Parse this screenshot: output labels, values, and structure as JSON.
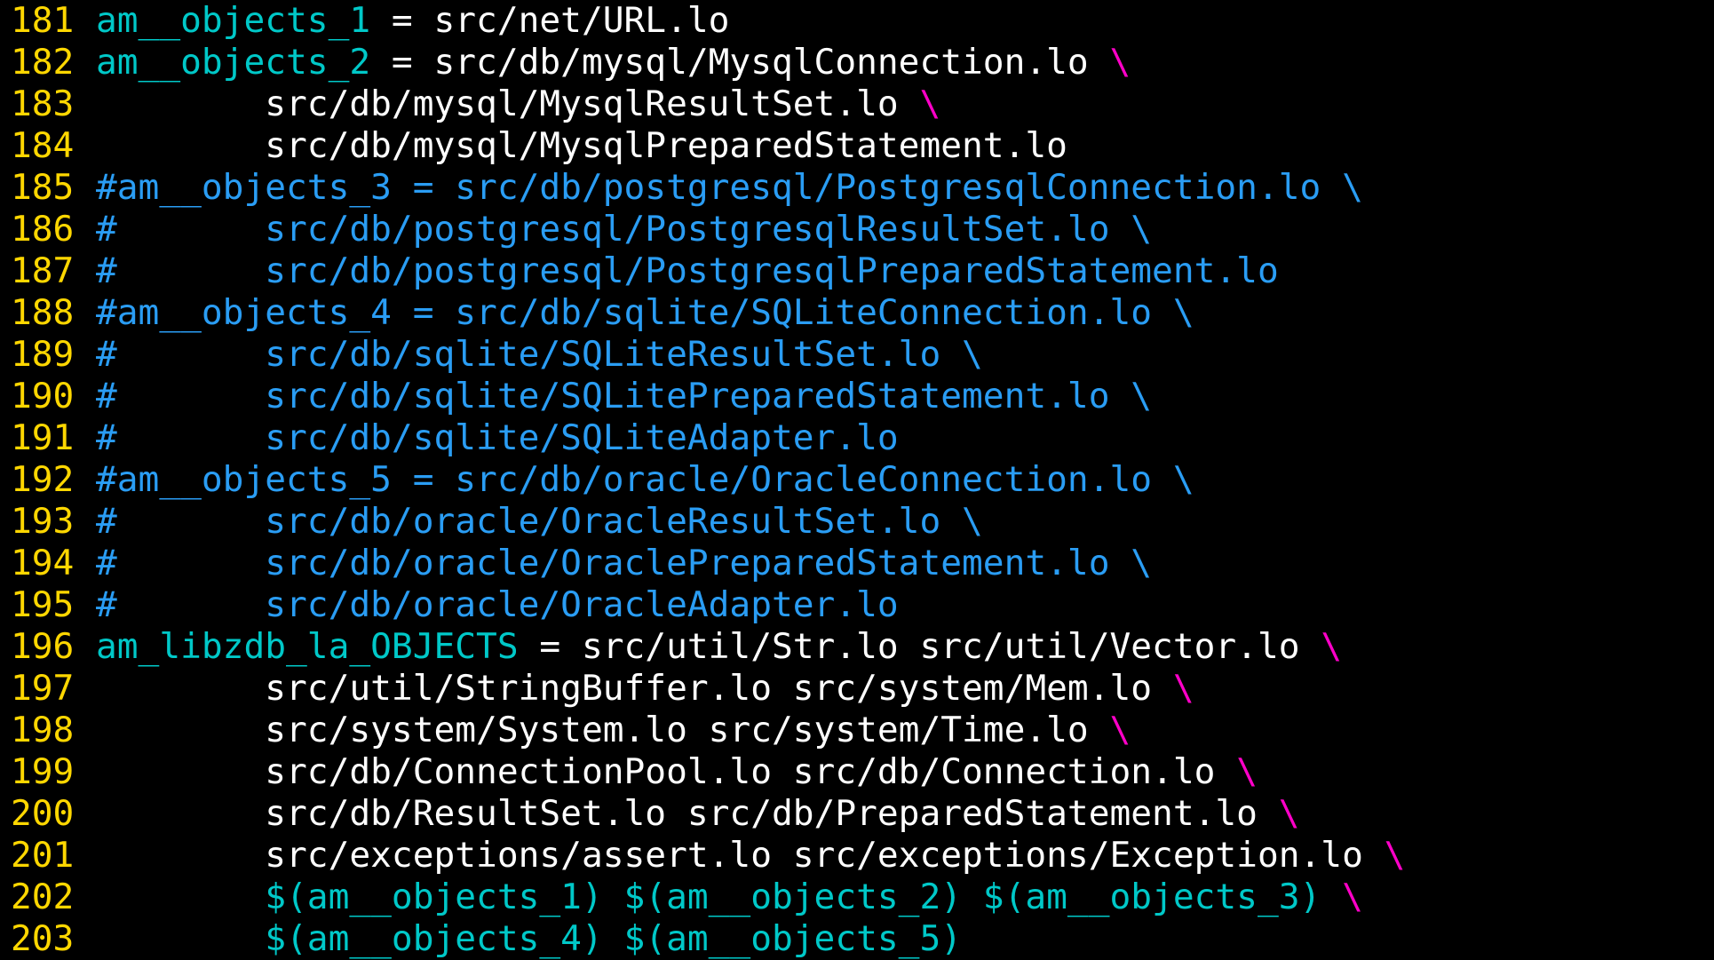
{
  "colors": {
    "background": "#000000",
    "line_number": "#ffd700",
    "variable": "#00c8c8",
    "plain": "#ffffff",
    "continuation": "#ff00c8",
    "comment": "#2a9df4"
  },
  "lines": [
    {
      "num": "181",
      "segments": [
        {
          "text": "am__objects_1",
          "kind": "var"
        },
        {
          "text": " = src/net/URL.lo",
          "kind": "plain"
        }
      ]
    },
    {
      "num": "182",
      "segments": [
        {
          "text": "am__objects_2",
          "kind": "var"
        },
        {
          "text": " = src/db/mysql/MysqlConnection.lo ",
          "kind": "plain"
        },
        {
          "text": "\\",
          "kind": "bs"
        }
      ]
    },
    {
      "num": "183",
      "segments": [
        {
          "text": "        src/db/mysql/MysqlResultSet.lo ",
          "kind": "plain"
        },
        {
          "text": "\\",
          "kind": "bs"
        }
      ]
    },
    {
      "num": "184",
      "segments": [
        {
          "text": "        src/db/mysql/MysqlPreparedStatement.lo",
          "kind": "plain"
        }
      ]
    },
    {
      "num": "185",
      "segments": [
        {
          "text": "#am__objects_3 = src/db/postgresql/PostgresqlConnection.lo \\",
          "kind": "comment"
        }
      ]
    },
    {
      "num": "186",
      "segments": [
        {
          "text": "#       src/db/postgresql/PostgresqlResultSet.lo \\",
          "kind": "comment"
        }
      ]
    },
    {
      "num": "187",
      "segments": [
        {
          "text": "#       src/db/postgresql/PostgresqlPreparedStatement.lo",
          "kind": "comment"
        }
      ]
    },
    {
      "num": "188",
      "segments": [
        {
          "text": "#am__objects_4 = src/db/sqlite/SQLiteConnection.lo \\",
          "kind": "comment"
        }
      ]
    },
    {
      "num": "189",
      "segments": [
        {
          "text": "#       src/db/sqlite/SQLiteResultSet.lo \\",
          "kind": "comment"
        }
      ]
    },
    {
      "num": "190",
      "segments": [
        {
          "text": "#       src/db/sqlite/SQLitePreparedStatement.lo \\",
          "kind": "comment"
        }
      ]
    },
    {
      "num": "191",
      "segments": [
        {
          "text": "#       src/db/sqlite/SQLiteAdapter.lo",
          "kind": "comment"
        }
      ]
    },
    {
      "num": "192",
      "segments": [
        {
          "text": "#am__objects_5 = src/db/oracle/OracleConnection.lo \\",
          "kind": "comment"
        }
      ]
    },
    {
      "num": "193",
      "segments": [
        {
          "text": "#       src/db/oracle/OracleResultSet.lo \\",
          "kind": "comment"
        }
      ]
    },
    {
      "num": "194",
      "segments": [
        {
          "text": "#       src/db/oracle/OraclePreparedStatement.lo \\",
          "kind": "comment"
        }
      ]
    },
    {
      "num": "195",
      "segments": [
        {
          "text": "#       src/db/oracle/OracleAdapter.lo",
          "kind": "comment"
        }
      ]
    },
    {
      "num": "196",
      "segments": [
        {
          "text": "am_libzdb_la_OBJECTS",
          "kind": "var"
        },
        {
          "text": " = src/util/Str.lo src/util/Vector.lo ",
          "kind": "plain"
        },
        {
          "text": "\\",
          "kind": "bs"
        }
      ]
    },
    {
      "num": "197",
      "segments": [
        {
          "text": "        src/util/StringBuffer.lo src/system/Mem.lo ",
          "kind": "plain"
        },
        {
          "text": "\\",
          "kind": "bs"
        }
      ]
    },
    {
      "num": "198",
      "segments": [
        {
          "text": "        src/system/System.lo src/system/Time.lo ",
          "kind": "plain"
        },
        {
          "text": "\\",
          "kind": "bs"
        }
      ]
    },
    {
      "num": "199",
      "segments": [
        {
          "text": "        src/db/ConnectionPool.lo src/db/Connection.lo ",
          "kind": "plain"
        },
        {
          "text": "\\",
          "kind": "bs"
        }
      ]
    },
    {
      "num": "200",
      "segments": [
        {
          "text": "        src/db/ResultSet.lo src/db/PreparedStatement.lo ",
          "kind": "plain"
        },
        {
          "text": "\\",
          "kind": "bs"
        }
      ]
    },
    {
      "num": "201",
      "segments": [
        {
          "text": "        src/exceptions/assert.lo src/exceptions/Exception.lo ",
          "kind": "plain"
        },
        {
          "text": "\\",
          "kind": "bs"
        }
      ]
    },
    {
      "num": "202",
      "segments": [
        {
          "text": "        ",
          "kind": "plain"
        },
        {
          "text": "$(am__objects_1) $(am__objects_2) $(am__objects_3)",
          "kind": "var"
        },
        {
          "text": " ",
          "kind": "plain"
        },
        {
          "text": "\\",
          "kind": "bs"
        }
      ]
    },
    {
      "num": "203",
      "segments": [
        {
          "text": "        ",
          "kind": "plain"
        },
        {
          "text": "$(am__objects_4) $(am__objects_5)",
          "kind": "var"
        }
      ]
    }
  ]
}
